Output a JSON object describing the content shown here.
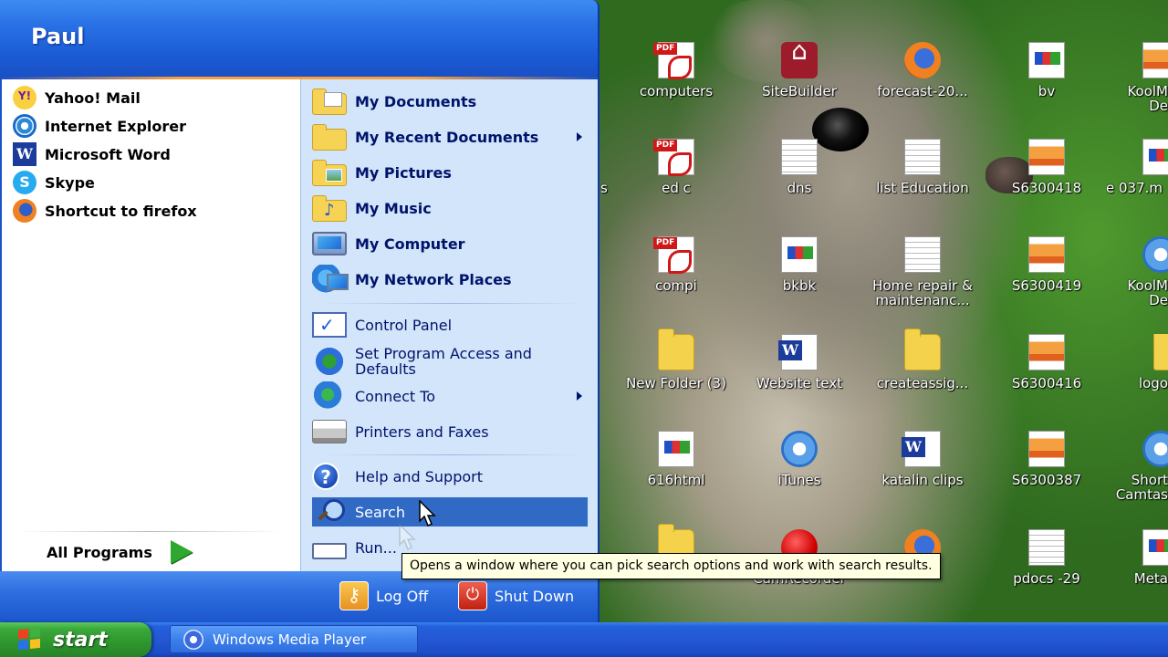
{
  "start_menu": {
    "user_name": "Paul",
    "pinned_programs": [
      {
        "label": "Yahoo! Mail",
        "icon": "yahoo-mail-icon"
      },
      {
        "label": "Internet Explorer",
        "icon": "internet-explorer-icon"
      },
      {
        "label": "Microsoft Word",
        "icon": "word-icon"
      },
      {
        "label": "Skype",
        "icon": "skype-icon"
      },
      {
        "label": "Shortcut to firefox",
        "icon": "firefox-icon"
      }
    ],
    "all_programs_label": "All Programs",
    "places": [
      {
        "label": "My Documents",
        "icon": "my-documents-icon"
      },
      {
        "label": "My Recent Documents",
        "icon": "folder-icon",
        "submenu": true
      },
      {
        "label": "My Pictures",
        "icon": "my-pictures-icon"
      },
      {
        "label": "My Music",
        "icon": "my-music-icon"
      },
      {
        "label": "My Computer",
        "icon": "my-computer-icon"
      },
      {
        "label": "My Network Places",
        "icon": "network-places-icon"
      }
    ],
    "system": [
      {
        "label": "Control Panel",
        "icon": "control-panel-icon"
      },
      {
        "label": "Set Program Access and Defaults",
        "icon": "program-access-icon"
      },
      {
        "label": "Connect To",
        "icon": "connect-to-icon",
        "submenu": true
      },
      {
        "label": "Printers and Faxes",
        "icon": "printer-icon"
      }
    ],
    "help": {
      "label": "Help and Support",
      "icon": "help-icon"
    },
    "search": {
      "label": "Search",
      "icon": "search-icon",
      "highlighted": true
    },
    "run": {
      "label": "Run...",
      "icon": "run-icon"
    },
    "log_off_label": "Log Off",
    "shut_down_label": "Shut Down"
  },
  "tooltip": "Opens a window where you can pick search options and work with search results.",
  "desktop_icons": [
    {
      "label": "computers",
      "icon": "pdf-icon"
    },
    {
      "label": "SiteBuilder",
      "icon": "sitebuilder-icon"
    },
    {
      "label": "forecast-20...",
      "icon": "firefox-icon"
    },
    {
      "label": "bv",
      "icon": "html-icon"
    },
    {
      "label": "KoolM De",
      "icon": "koolmoves-icon"
    },
    {
      "label": "ed c",
      "icon": "pdf-icon"
    },
    {
      "label": "dns",
      "icon": "document-icon"
    },
    {
      "label": "list Education",
      "icon": "document-icon"
    },
    {
      "label": "S6300418",
      "icon": "image-icon"
    },
    {
      "label": "e 037.m",
      "icon": "html-icon"
    },
    {
      "label": "s",
      "icon": ""
    },
    {
      "label": "compi",
      "icon": "pdf-icon"
    },
    {
      "label": "bkbk",
      "icon": "html-icon"
    },
    {
      "label": "Home repair & maintenanc...",
      "icon": "document-icon"
    },
    {
      "label": "S6300419",
      "icon": "image-icon"
    },
    {
      "label": "KoolM De",
      "icon": "koolmoves-icon"
    },
    {
      "label": "New Folder (3)",
      "icon": "folder-icon"
    },
    {
      "label": "Website text",
      "icon": "word-icon"
    },
    {
      "label": "createassig...",
      "icon": "folder-icon"
    },
    {
      "label": "S6300416",
      "icon": "image-icon"
    },
    {
      "label": "logo",
      "icon": "folder-icon"
    },
    {
      "label": "616html",
      "icon": "html-icon"
    },
    {
      "label": "iTunes",
      "icon": "itunes-icon"
    },
    {
      "label": "katalin clips",
      "icon": "word-icon"
    },
    {
      "label": "S6300387",
      "icon": "image-icon"
    },
    {
      "label": "Short Camtas",
      "icon": "camtasia-icon"
    },
    {
      "label": "CamRecorder",
      "icon": "recorder-icon"
    },
    {
      "label": "pdocs -29",
      "icon": "document-icon"
    },
    {
      "label": "Meta",
      "icon": "meta-icon"
    }
  ],
  "taskbar": {
    "start_label": "start",
    "tasks": [
      {
        "label": "Windows Media Player",
        "icon": "media-player-icon"
      }
    ]
  }
}
